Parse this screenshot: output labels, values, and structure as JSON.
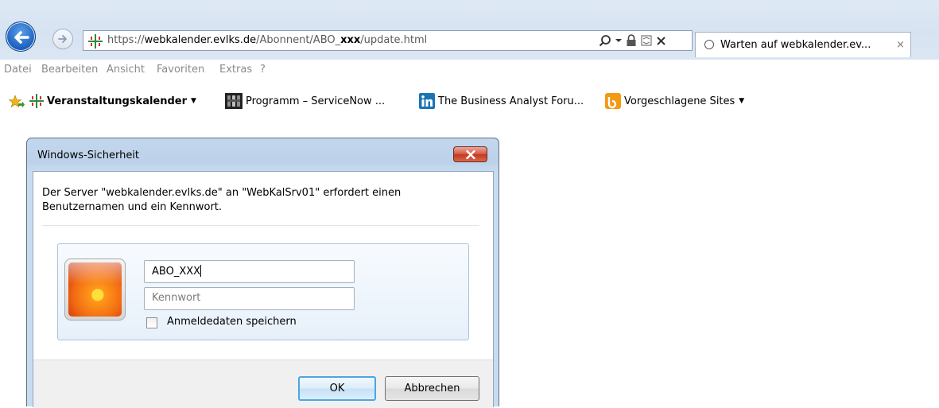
{
  "browser": {
    "address": {
      "prefix": "https://",
      "domain": "webkalender.evlks.de",
      "path_1": "/Abonnent/ABO_",
      "path_bold": "xxx",
      "path_2": "/update.html"
    },
    "tab": {
      "title": "Warten auf webkalender.ev...",
      "close": "×"
    },
    "menu": [
      "Datei",
      "Bearbeiten",
      "Ansicht",
      "Favoriten",
      "Extras",
      "?"
    ],
    "favorites": [
      {
        "label": "Veranstaltungskalender",
        "icon": "cross-logo-icon",
        "has_dropdown": true
      },
      {
        "label": "Programm – ServiceNow ...",
        "icon": "servicenow-icon",
        "has_dropdown": false
      },
      {
        "label": "The Business Analyst Foru...",
        "icon": "linkedin-icon",
        "has_dropdown": false
      },
      {
        "label": "Vorgeschlagene Sites",
        "icon": "suggested-sites-icon",
        "has_dropdown": true
      }
    ]
  },
  "dialog": {
    "title": "Windows-Sicherheit",
    "message_line1": "Der Server \"webkalender.evlks.de\" an \"WebKalSrv01\" erfordert einen",
    "message_line2": "Benutzernamen und ein Kennwort.",
    "username_value": "ABO_XXX",
    "password_placeholder": "Kennwort",
    "remember_label": "Anmeldedaten speichern",
    "remember_checked": false,
    "ok_label": "OK",
    "cancel_label": "Abbrechen"
  },
  "colors": {
    "chrome_bg": "#d6e3f2",
    "back_button": "#1b5fbf",
    "close_button": "#c0381f",
    "ok_button_border": "#4aa6e6"
  }
}
